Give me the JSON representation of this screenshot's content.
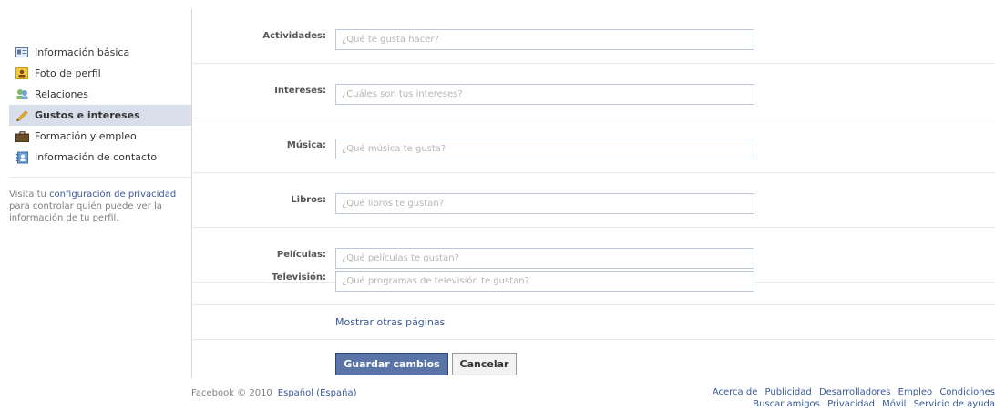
{
  "sidebar": {
    "items": [
      {
        "label": "Información básica",
        "icon": "info-card-icon"
      },
      {
        "label": "Foto de perfil",
        "icon": "profile-photo-icon"
      },
      {
        "label": "Relaciones",
        "icon": "relationships-icon"
      },
      {
        "label": "Gustos e intereses",
        "icon": "pencil-icon",
        "active": true
      },
      {
        "label": "Formación y empleo",
        "icon": "briefcase-icon"
      },
      {
        "label": "Información de contacto",
        "icon": "contact-book-icon"
      }
    ],
    "privacy_prefix": "Visita tu ",
    "privacy_link": "configuración de privacidad",
    "privacy_suffix": " para controlar quién puede ver la información de tu perfil."
  },
  "form": {
    "fields": [
      {
        "label": "Actividades:",
        "placeholder": "¿Qué te gusta hacer?",
        "value": ""
      },
      {
        "label": "Intereses:",
        "placeholder": "¿Cuáles son tus intereses?",
        "value": ""
      },
      {
        "label": "Música:",
        "placeholder": "¿Qué música te gusta?",
        "value": ""
      },
      {
        "label": "Libros:",
        "placeholder": "¿Qué libros te gustan?",
        "value": ""
      },
      {
        "label": "Películas:",
        "placeholder": "¿Qué películas te gustan?",
        "value": ""
      },
      {
        "label": "Televisión:",
        "placeholder": "¿Qué programas de televisión te gustan?",
        "value": ""
      }
    ],
    "more_pages_link": "Mostrar otras páginas",
    "save_label": "Guardar cambios",
    "cancel_label": "Cancelar"
  },
  "footer": {
    "copyright": "Facebook © 2010",
    "language": "Español (España)",
    "links_row1": [
      "Acerca de",
      "Publicidad",
      "Desarrolladores",
      "Empleo",
      "Condiciones"
    ],
    "links_row2": [
      "Buscar amigos",
      "Privacidad",
      "Móvil",
      "Servicio de ayuda"
    ]
  },
  "colors": {
    "link": "#3b5998",
    "active_nav_bg": "#d8dfea",
    "save_button_bg": "#5b74a8"
  }
}
